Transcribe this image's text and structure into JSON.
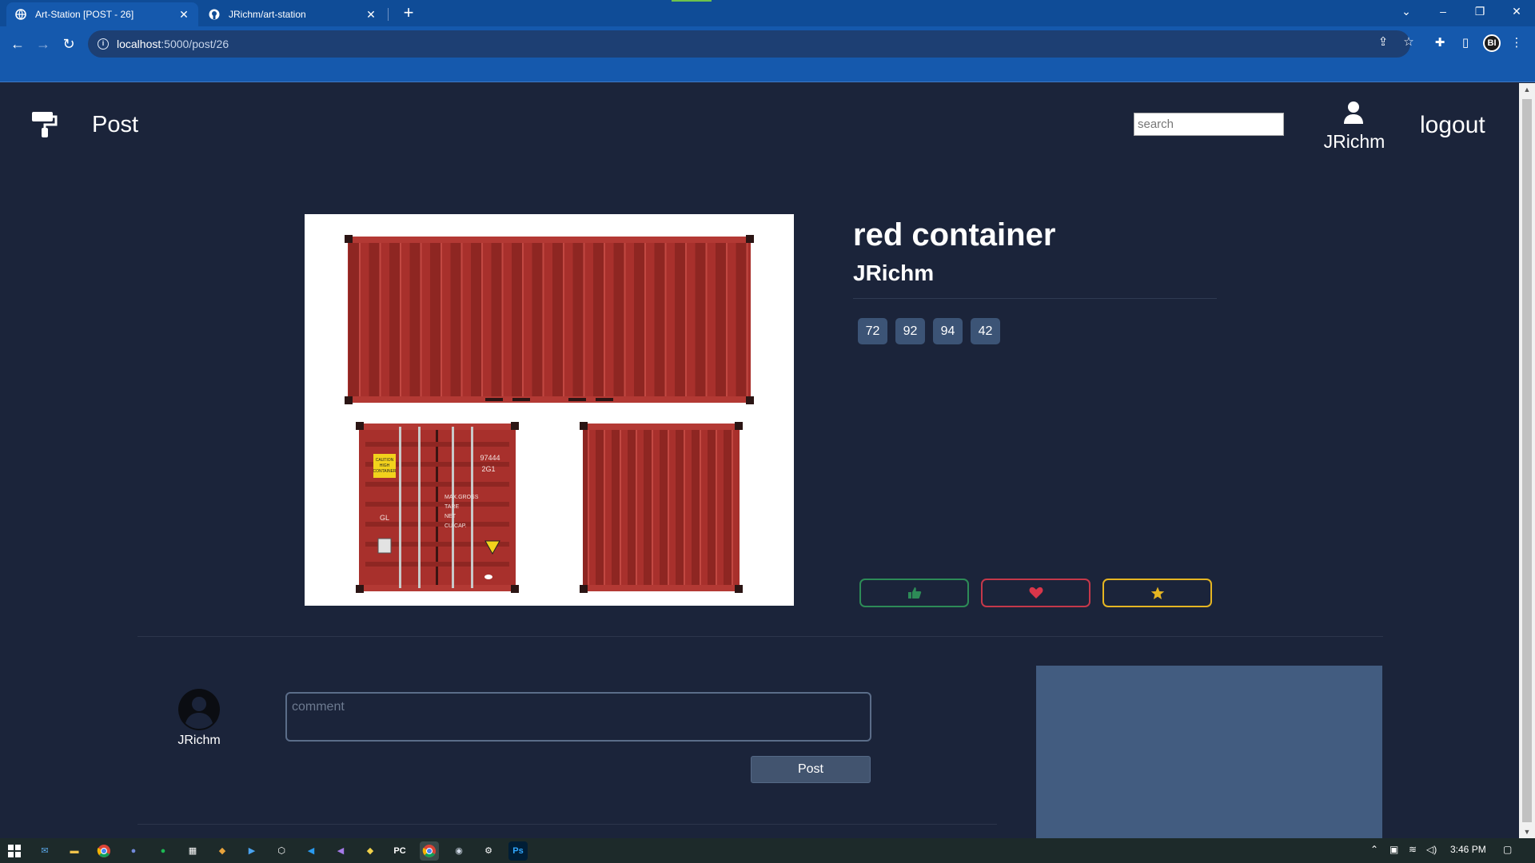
{
  "browser": {
    "tabs": [
      {
        "title": "Art-Station [POST - 26]",
        "active": true,
        "icon": "globe-icon"
      },
      {
        "title": "JRichm/art-station",
        "active": false,
        "icon": "github-icon"
      }
    ],
    "url_host": "localhost",
    "url_path": ":5000/post/26",
    "profile_initials": "BI"
  },
  "header": {
    "page_title": "Post",
    "search_placeholder": "search",
    "username": "JRichm",
    "logout_label": "logout"
  },
  "post": {
    "title": "red container",
    "author": "JRichm",
    "tags": [
      "72",
      "92",
      "94",
      "42"
    ],
    "container_labels": {
      "caution": "CAUTION HIGH CONTAINER",
      "code": "97444",
      "type": "2G1",
      "letters": "GL",
      "specs": "MAX.GROSS TARE NET CU.CAP."
    }
  },
  "reactions": {
    "like_icon": "thumbs-up-icon",
    "heart_icon": "heart-icon",
    "star_icon": "star-icon",
    "like_color": "#2d8b57",
    "heart_color": "#c5384a",
    "star_color": "#e5b522"
  },
  "comment": {
    "username": "JRichm",
    "placeholder": "comment",
    "post_label": "Post"
  },
  "taskbar": {
    "time": "3:46 PM"
  },
  "colors": {
    "page_bg": "#1b243a",
    "tag_bg": "#3c5476",
    "container_red": "#a8302c"
  }
}
